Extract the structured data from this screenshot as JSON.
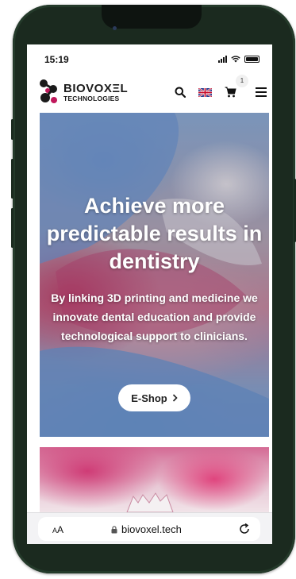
{
  "status_bar": {
    "time": "15:19"
  },
  "header": {
    "logo_line1": "BIOVOXΞL",
    "logo_line2": "TECHNOLOGIES",
    "cart_count": "1"
  },
  "hero": {
    "title": "Achieve more predictable results in dentistry",
    "subtitle": "By linking 3D printing and medicine we innovate dental education and provide technological support to clinicians.",
    "cta_label": "E-Shop",
    "cta_icon": "chevron-right-icon"
  },
  "browser": {
    "text_size_label_small": "A",
    "text_size_label": "A",
    "url": "biovoxel.tech"
  }
}
